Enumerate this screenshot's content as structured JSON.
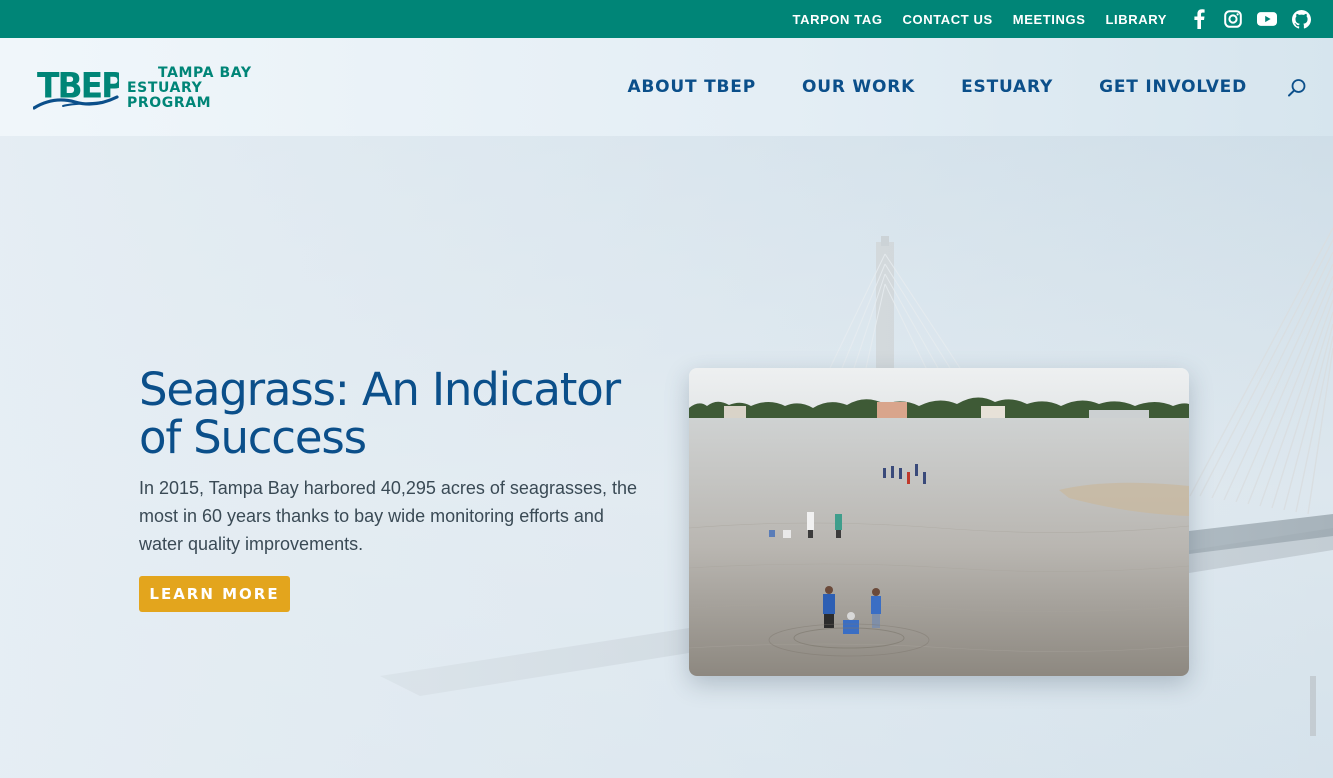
{
  "topbar": {
    "links": [
      "TARPON TAG",
      "CONTACT US",
      "MEETINGS",
      "LIBRARY"
    ],
    "social_icons": [
      "facebook-icon",
      "instagram-icon",
      "youtube-icon",
      "github-icon"
    ],
    "color": "#008577"
  },
  "header": {
    "logo": {
      "mark": "TBEP",
      "line1": "TAMPA BAY",
      "line2": "ESTUARY PROGRAM"
    },
    "nav": [
      "ABOUT TBEP",
      "OUR WORK",
      "ESTUARY",
      "GET INVOLVED"
    ],
    "search_icon": "search-icon",
    "nav_color": "#0b4f8a"
  },
  "hero": {
    "title": "Seagrass: An Indicator of Success",
    "text": "In 2015, Tampa Bay harbored 40,295 acres of seagrasses, the most in 60 years thanks to bay wide monitoring efforts and water quality improvements.",
    "button_label": "LEARN MORE",
    "button_color": "#e3a51d",
    "photo_description_icon": "seagrass-monitoring-photo"
  }
}
